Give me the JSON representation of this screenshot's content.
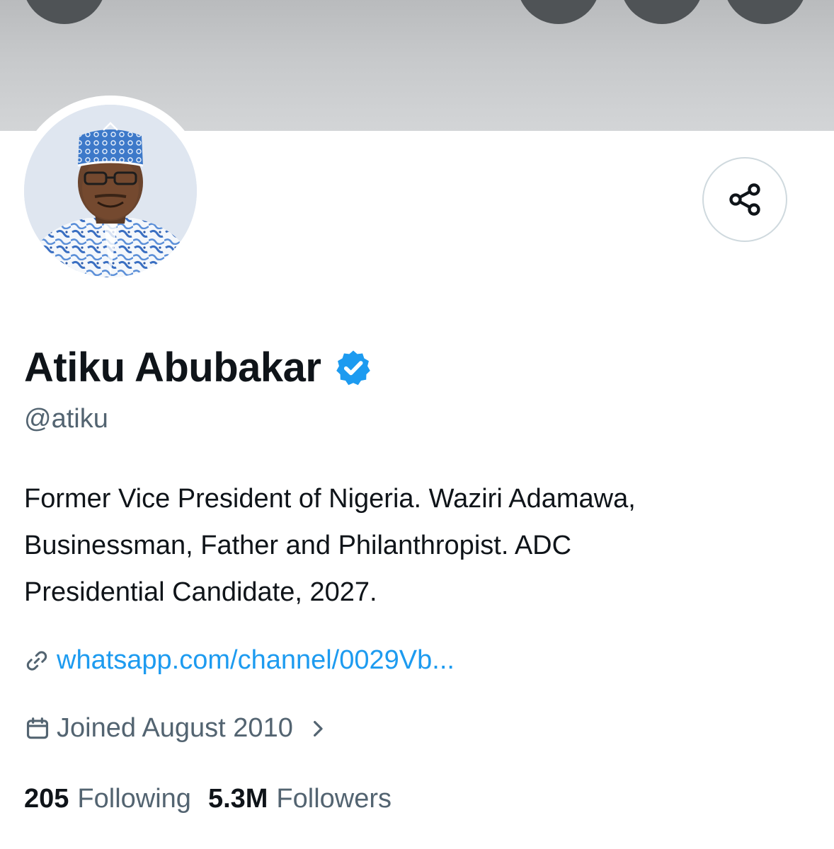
{
  "profile": {
    "display_name": "Atiku Abubakar",
    "handle": "@atiku",
    "bio_lines": [
      "Former Vice President of Nigeria. Waziri Adamawa,",
      "Businessman, Father and Philanthropist. ADC",
      "Presidential Candidate, 2027."
    ],
    "link": "whatsapp.com/channel/0029Vb...",
    "joined": "Joined August 2010",
    "following_count": "205",
    "following_label": "Following",
    "followers_count": "5.3M",
    "followers_label": "Followers"
  },
  "icons": {
    "verified": "verified-badge-icon",
    "share": "share-icon",
    "link": "link-icon",
    "calendar": "calendar-icon",
    "chevron": "chevron-right-icon"
  },
  "colors": {
    "accent": "#1d9bf0",
    "text_primary": "#0f1419",
    "text_secondary": "#536471",
    "border": "#cfd9de"
  }
}
